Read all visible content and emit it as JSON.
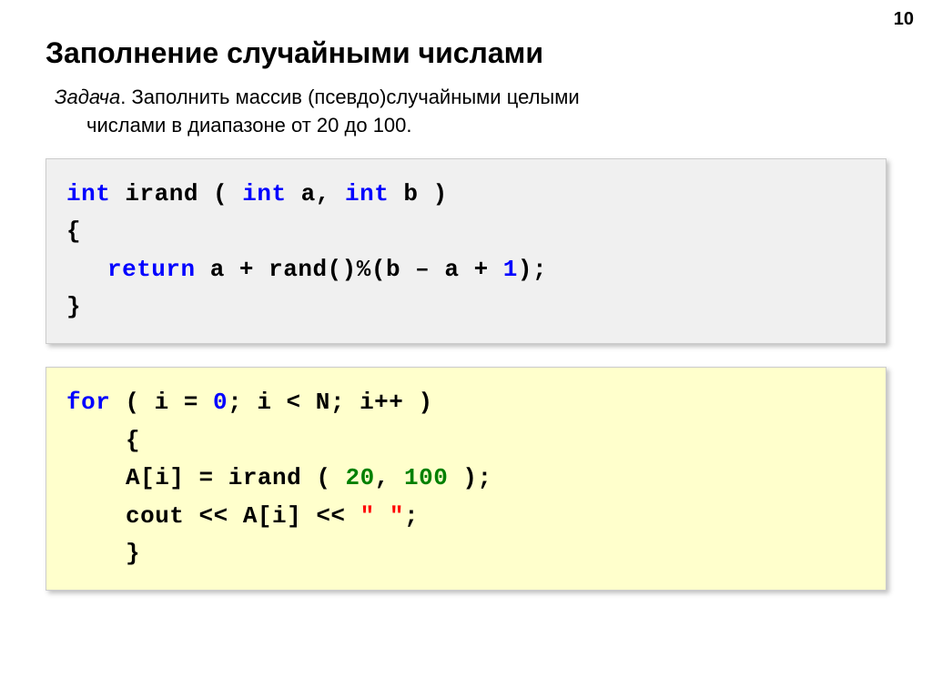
{
  "page_number": "10",
  "title": "Заполнение случайными числами",
  "task": {
    "label": "Задача",
    "text1": ". Заполнить массив (псевдо)случайными целыми",
    "text2": "числами в диапазоне от 20 до 100."
  },
  "code1": {
    "int1": "int",
    "irand": " irand ( ",
    "int2": "int",
    "a": " a, ",
    "int3": "int",
    "b": " b )",
    "open": "{",
    "return": "return",
    "expr1": " a + rand()%(b – a + ",
    "one": "1",
    "expr2": ");",
    "close": "}"
  },
  "code2": {
    "for": "for",
    "cond1": " ( i = ",
    "zero": "0",
    "cond2": "; i < N; i++ )",
    "open": "{",
    "assign1": "A[i] = irand ( ",
    "n20": "20",
    "comma": ", ",
    "n100": "100",
    "assign2": " );",
    "cout1": "cout << A[i] << ",
    "str": "\" \"",
    "cout2": ";",
    "close": "}"
  }
}
